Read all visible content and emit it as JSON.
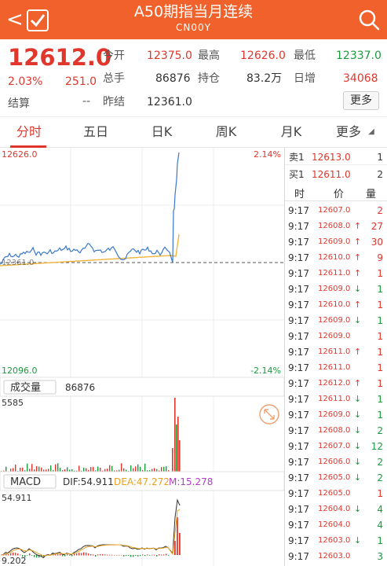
{
  "header": {
    "back_glyph": "<",
    "title": "A50期指当月连续",
    "code": "CN00Y"
  },
  "quote": {
    "price": "12612.0",
    "change_pct": "2.03%",
    "change": "251.0",
    "settle_label": "结算",
    "settle_value": "--",
    "open_label": "今开",
    "open_value": "12375.0",
    "high_label": "最高",
    "high_value": "12626.0",
    "low_label": "最低",
    "low_value": "12337.0",
    "volume_label": "总手",
    "volume_value": "86876",
    "oi_label": "持仓",
    "oi_value": "83.2万",
    "daily_inc_label": "日增",
    "daily_inc_value": "34068",
    "prev_settle_label": "昨结",
    "prev_settle_value": "12361.0",
    "more_label": "更多"
  },
  "tabs": [
    {
      "label": "分时",
      "active": true
    },
    {
      "label": "五日",
      "active": false
    },
    {
      "label": "日K",
      "active": false
    },
    {
      "label": "周K",
      "active": false
    },
    {
      "label": "月K",
      "active": false
    },
    {
      "label": "更多",
      "active": false
    }
  ],
  "price_chart": {
    "y_high_label": "12626.0",
    "y_high_pct": "2.14%",
    "y_low_label": "12096.0",
    "y_low_pct": "-2.14%",
    "prev_close_label": "12361.0"
  },
  "volume_chart": {
    "title": "成交量",
    "value": "86876",
    "max_label": "5585"
  },
  "macd_chart": {
    "title": "MACD",
    "dif_label": "DIF:54.911",
    "dea_label": "DEA:47.272",
    "m_label": "M:15.278",
    "max_label": "54.911",
    "min_label": "9.202"
  },
  "order_book": {
    "ask_label": "卖1",
    "ask_price": "12613.0",
    "ask_qty": "1",
    "bid_label": "买1",
    "bid_price": "12611.0",
    "bid_qty": "2",
    "col_time": "时",
    "col_price": "价",
    "col_qty": "量",
    "ticks": [
      {
        "time": "9:17",
        "price": "12607.0",
        "arrow": "",
        "qty": "2",
        "color": "red"
      },
      {
        "time": "9:17",
        "price": "12608.0",
        "arrow": "↑",
        "qty": "27",
        "color": "red"
      },
      {
        "time": "9:17",
        "price": "12609.0",
        "arrow": "↑",
        "qty": "30",
        "color": "red"
      },
      {
        "time": "9:17",
        "price": "12610.0",
        "arrow": "↑",
        "qty": "9",
        "color": "red"
      },
      {
        "time": "9:17",
        "price": "12611.0",
        "arrow": "↑",
        "qty": "1",
        "color": "red"
      },
      {
        "time": "9:17",
        "price": "12609.0",
        "arrow": "↓",
        "qty": "1",
        "color": "green"
      },
      {
        "time": "9:17",
        "price": "12610.0",
        "arrow": "↑",
        "qty": "1",
        "color": "red"
      },
      {
        "time": "9:17",
        "price": "12609.0",
        "arrow": "↓",
        "qty": "1",
        "color": "green"
      },
      {
        "time": "9:17",
        "price": "12609.0",
        "arrow": "",
        "qty": "1",
        "color": "red"
      },
      {
        "time": "9:17",
        "price": "12611.0",
        "arrow": "↑",
        "qty": "1",
        "color": "red"
      },
      {
        "time": "9:17",
        "price": "12611.0",
        "arrow": "",
        "qty": "1",
        "color": "red"
      },
      {
        "time": "9:17",
        "price": "12612.0",
        "arrow": "↑",
        "qty": "1",
        "color": "red"
      },
      {
        "time": "9:17",
        "price": "12611.0",
        "arrow": "↓",
        "qty": "1",
        "color": "green"
      },
      {
        "time": "9:17",
        "price": "12609.0",
        "arrow": "↓",
        "qty": "1",
        "color": "green"
      },
      {
        "time": "9:17",
        "price": "12608.0",
        "arrow": "↓",
        "qty": "2",
        "color": "green"
      },
      {
        "time": "9:17",
        "price": "12607.0",
        "arrow": "↓",
        "qty": "12",
        "color": "green"
      },
      {
        "time": "9:17",
        "price": "12606.0",
        "arrow": "↓",
        "qty": "2",
        "color": "green"
      },
      {
        "time": "9:17",
        "price": "12605.0",
        "arrow": "↓",
        "qty": "2",
        "color": "green"
      },
      {
        "time": "9:17",
        "price": "12605.0",
        "arrow": "",
        "qty": "1",
        "color": "red"
      },
      {
        "time": "9:17",
        "price": "12604.0",
        "arrow": "↓",
        "qty": "4",
        "color": "green"
      },
      {
        "time": "9:17",
        "price": "12604.0",
        "arrow": "",
        "qty": "4",
        "color": "green"
      },
      {
        "time": "9:17",
        "price": "12603.0",
        "arrow": "↓",
        "qty": "1",
        "color": "green"
      },
      {
        "time": "9:17",
        "price": "12603.0",
        "arrow": "",
        "qty": "3",
        "color": "green"
      }
    ]
  },
  "colors": {
    "brand": "#f0612b",
    "up": "#e0362c",
    "down": "#1a9b3c",
    "price_line": "#3a78c9",
    "avg_line": "#f0b43c"
  }
}
